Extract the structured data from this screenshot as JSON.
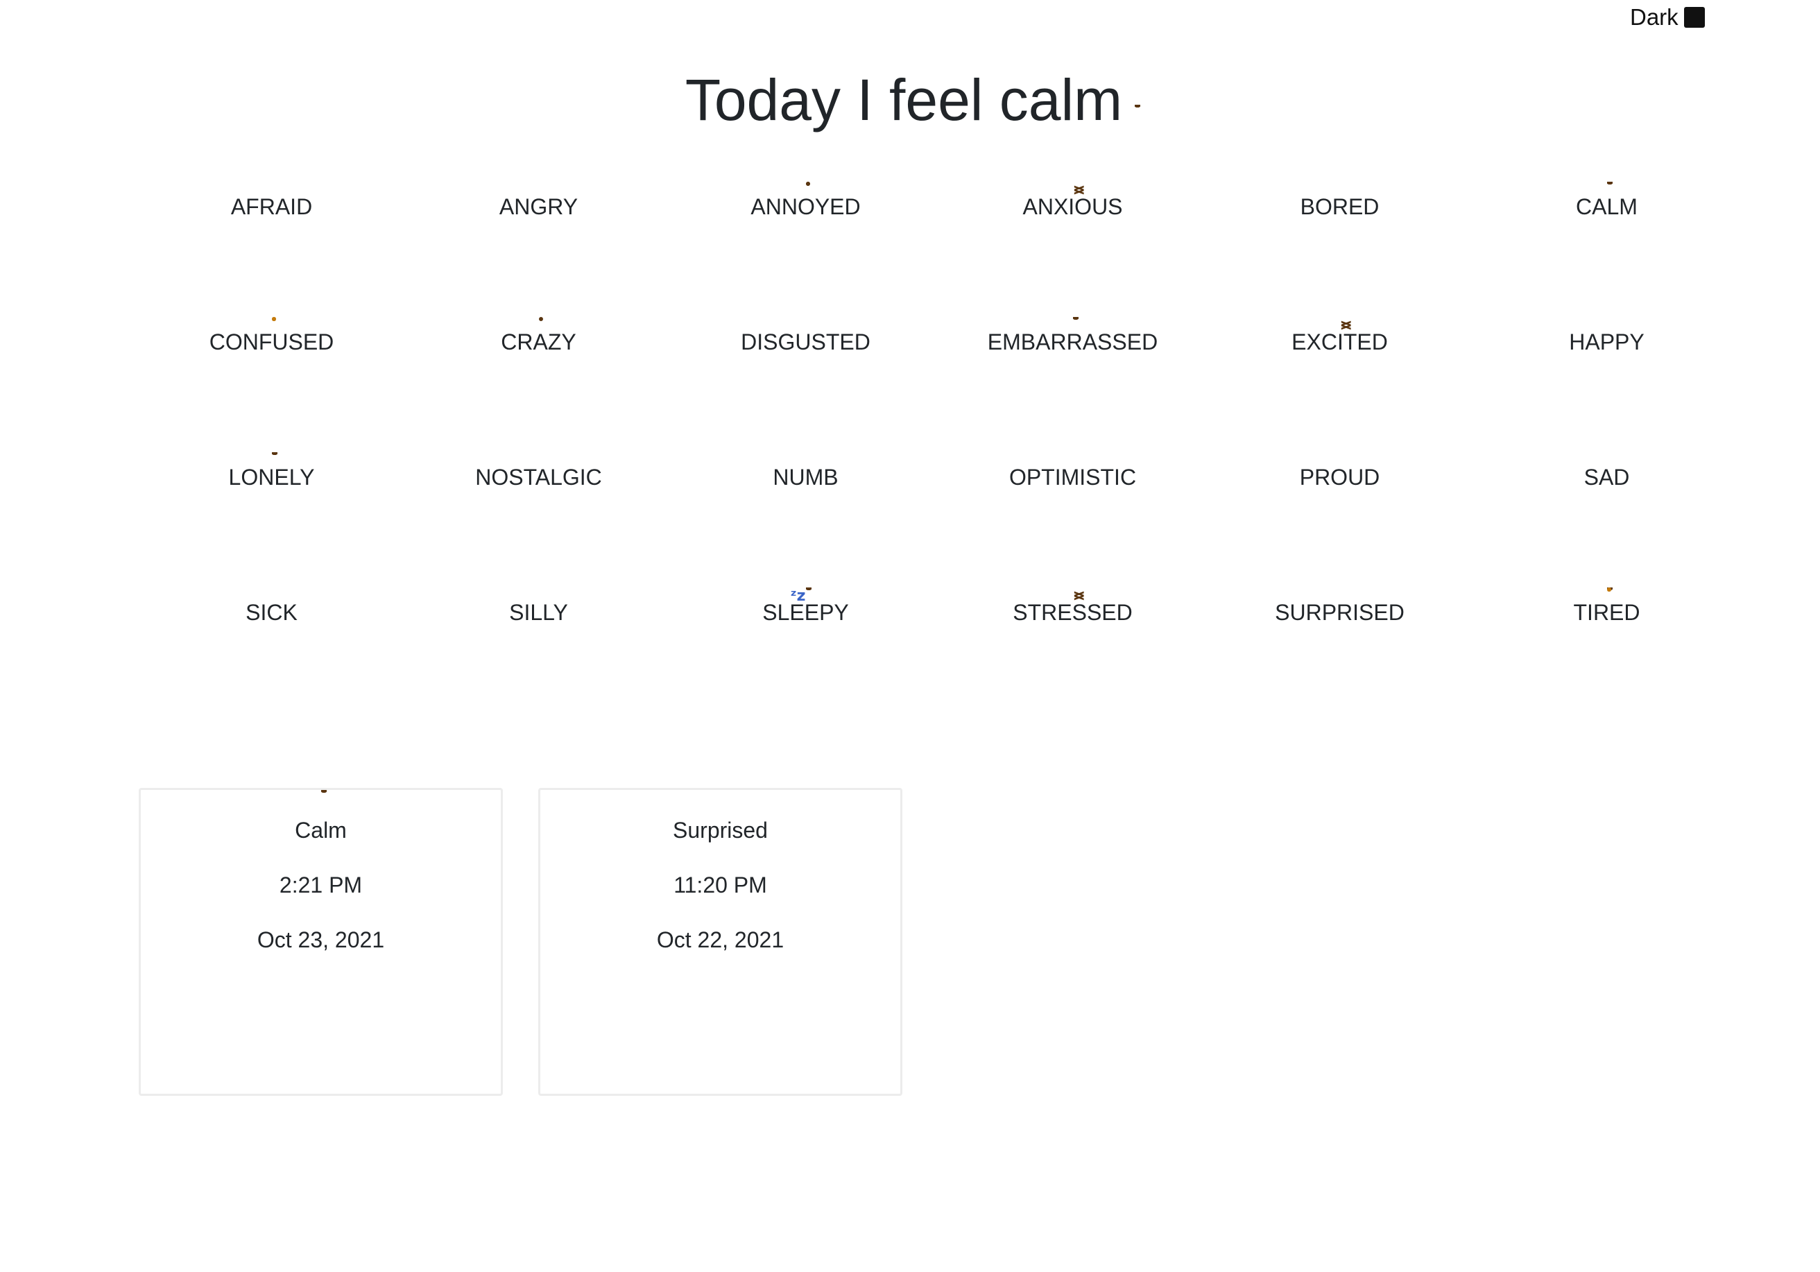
{
  "header": {
    "theme_toggle_label": "Dark"
  },
  "title": {
    "text": "Today I feel calm",
    "emoji": "calm"
  },
  "moods": [
    {
      "label": "AFRAID",
      "icon": "afraid-face"
    },
    {
      "label": "ANGRY",
      "icon": "angry-face"
    },
    {
      "label": "ANNOYED",
      "icon": "eye-roll-face"
    },
    {
      "label": "ANXIOUS",
      "icon": "anxious-face"
    },
    {
      "label": "BORED",
      "icon": "bored-face"
    },
    {
      "label": "CALM",
      "icon": "calm-face"
    },
    {
      "label": "CONFUSED",
      "icon": "thinking-face"
    },
    {
      "label": "CRAZY",
      "icon": "crazy-face"
    },
    {
      "label": "DISGUSTED",
      "icon": "unamused-face"
    },
    {
      "label": "EMBARRASSED",
      "icon": "sweat-smile-face"
    },
    {
      "label": "EXCITED",
      "icon": "grinning-squint-face"
    },
    {
      "label": "HAPPY",
      "icon": "slight-smile-face"
    },
    {
      "label": "LONELY",
      "icon": "pensive-face"
    },
    {
      "label": "NOSTALGIC",
      "icon": "crying-face"
    },
    {
      "label": "NUMB",
      "icon": "neutral-face"
    },
    {
      "label": "OPTIMISTIC",
      "icon": "smiley-face"
    },
    {
      "label": "PROUD",
      "icon": "sunglasses-face"
    },
    {
      "label": "SAD",
      "icon": "frowning-face"
    },
    {
      "label": "SICK",
      "icon": "nauseated-face"
    },
    {
      "label": "SILLY",
      "icon": "clown-face"
    },
    {
      "label": "SLEEPY",
      "icon": "sleeping-face"
    },
    {
      "label": "STRESSED",
      "icon": "steam-face"
    },
    {
      "label": "SURPRISED",
      "icon": "hushed-face"
    },
    {
      "label": "TIRED",
      "icon": "yawning-face"
    }
  ],
  "entries": [
    {
      "mood": "Calm",
      "icon": "calm-face",
      "time": "2:21 PM",
      "date": "Oct 23, 2021"
    },
    {
      "mood": "Surprised",
      "icon": "hushed-face",
      "time": "11:20 PM",
      "date": "Oct 22, 2021"
    }
  ],
  "colors": {
    "text": "#212529",
    "card_border": "#ececec",
    "emoji_yellow": "#ffcc33"
  }
}
